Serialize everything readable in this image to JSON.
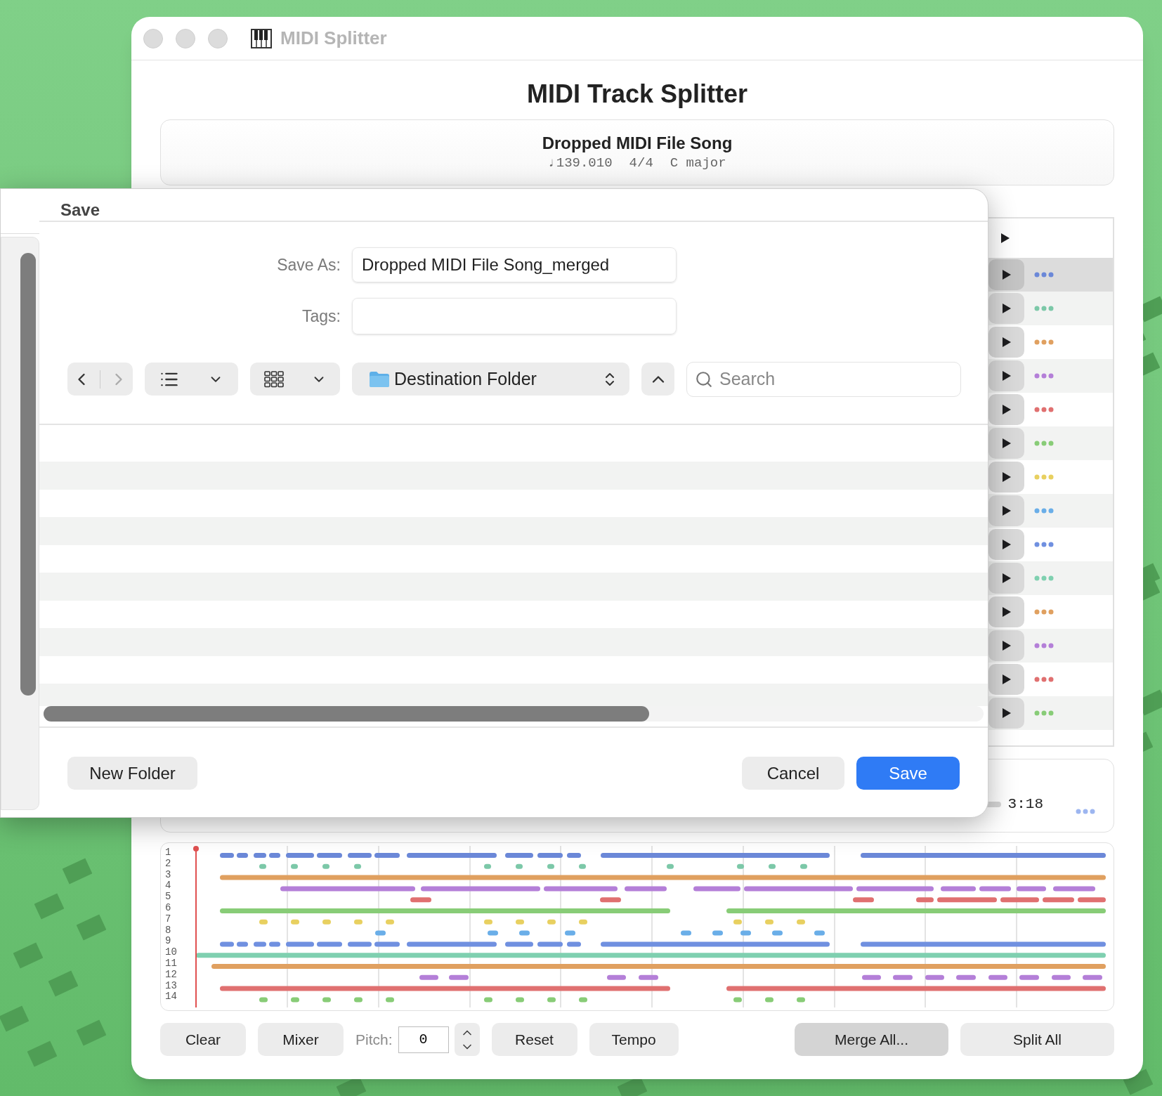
{
  "window": {
    "title": "MIDI Splitter"
  },
  "heading": "MIDI Track Splitter",
  "song": {
    "title": "Dropped MIDI File Song",
    "tempo": "♩139.010",
    "time_signature": "4/4",
    "key": "C major"
  },
  "tracks": [
    {
      "selected": true,
      "color": "#6b88d8"
    },
    {
      "selected": false,
      "color": "#7cc8a8"
    },
    {
      "selected": false,
      "color": "#e0a060"
    },
    {
      "selected": false,
      "color": "#b47fd8"
    },
    {
      "selected": false,
      "color": "#e07070"
    },
    {
      "selected": false,
      "color": "#88cc77"
    },
    {
      "selected": false,
      "color": "#e8d060"
    },
    {
      "selected": false,
      "color": "#6aaee8"
    },
    {
      "selected": false,
      "color": "#7090e0"
    },
    {
      "selected": false,
      "color": "#7fd0b0"
    },
    {
      "selected": false,
      "color": "#e0a060"
    },
    {
      "selected": false,
      "color": "#b47fd8"
    },
    {
      "selected": false,
      "color": "#e07070"
    },
    {
      "selected": false,
      "color": "#88cc77"
    }
  ],
  "transport": {
    "time": "3:18"
  },
  "piano_roll": {
    "row_labels": [
      "1",
      "2",
      "3",
      "4",
      "5",
      "6",
      "7",
      "8",
      "9",
      "10",
      "11",
      "12",
      "13",
      "14"
    ]
  },
  "controls": [
    {
      "kind": "button",
      "label": "Clear",
      "highlighted": false
    },
    {
      "kind": "button",
      "label": "Mixer",
      "highlighted": false
    },
    {
      "kind": "stepper",
      "label": "Pitch:",
      "value": "0"
    },
    {
      "kind": "button",
      "label": "Reset",
      "highlighted": false
    },
    {
      "kind": "button",
      "label": "Tempo",
      "highlighted": false
    },
    {
      "kind": "spacer"
    },
    {
      "kind": "button",
      "label": "Merge All...",
      "highlighted": true
    },
    {
      "kind": "button",
      "label": "Split All",
      "highlighted": false
    }
  ],
  "save_sheet": {
    "title": "Save",
    "save_as": {
      "label": "Save As:",
      "value": "Dropped MIDI File Song_merged"
    },
    "tags": {
      "label": "Tags:"
    },
    "location": "Destination Folder",
    "search": {
      "placeholder": "Search"
    },
    "new_folder": "New Folder",
    "cancel": "Cancel",
    "save": "Save"
  }
}
